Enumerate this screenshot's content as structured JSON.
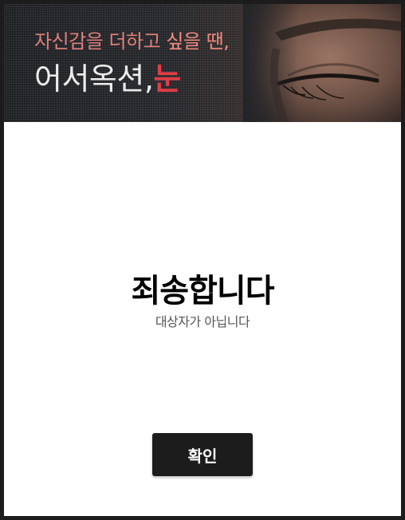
{
  "banner": {
    "tagline_prefix": "자신감을 더하고 ",
    "tagline_highlight": "싶을 땐,",
    "title_main": "어서옥션,",
    "title_highlight": "눈",
    "image": "woman-eye-closeup"
  },
  "message": {
    "headline": "죄송합니다",
    "subtext": "대상자가 아닙니다"
  },
  "actions": {
    "confirm_label": "확인"
  },
  "colors": {
    "frame": "#1c1c1c",
    "banner_dark": "#1d1f23",
    "tagline": "#e07f78",
    "title": "#ececec",
    "accent_red": "#e23d46",
    "button_bg": "#1c1c1c",
    "button_text": "#ffffff"
  }
}
